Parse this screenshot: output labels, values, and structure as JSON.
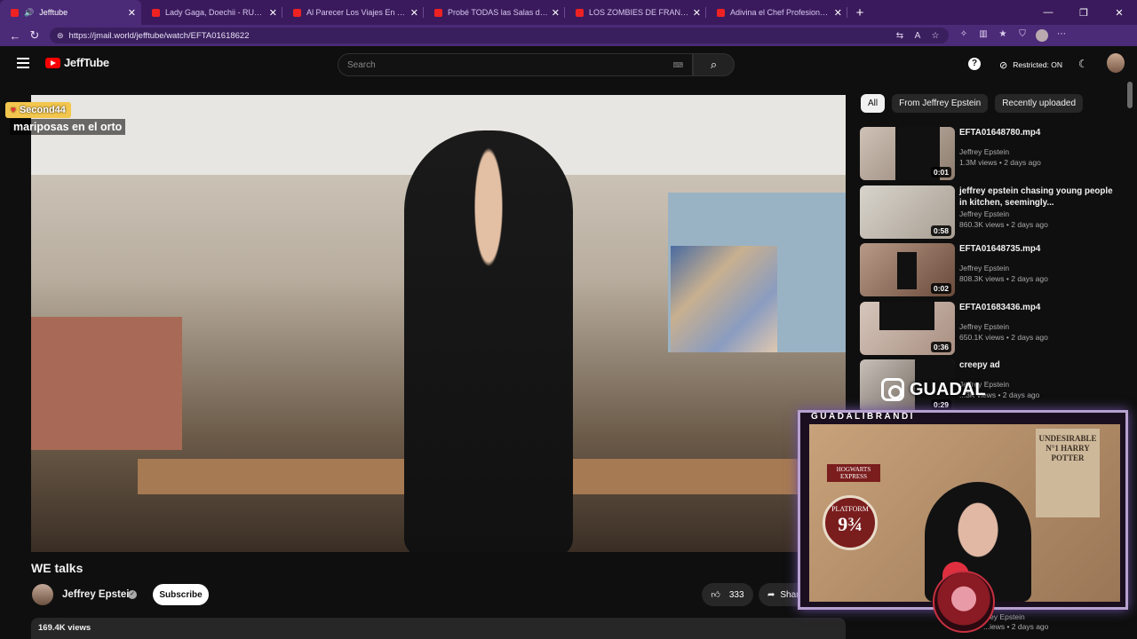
{
  "browser": {
    "tabs": [
      {
        "title": "Jefftube",
        "active": true,
        "audio": true
      },
      {
        "title": "Lady Gaga, Doechii - RUNWAY (O",
        "active": false
      },
      {
        "title": "Al Parecer Los Viajes En El Tiempo",
        "active": false
      },
      {
        "title": "Probé TODAS las Salas de Cine en",
        "active": false
      },
      {
        "title": "LOS ZOMBIES DE FRANKFURT (JA",
        "active": false
      },
      {
        "title": "Adivina el Chef Profesional - YouT",
        "active": false
      }
    ],
    "url": "https://jmail.world/jefftube/watch/EFTA01618622"
  },
  "header": {
    "logo_text": "JeffTube",
    "search_placeholder": "Search",
    "restricted_label": "Restricted: ON"
  },
  "overlay": {
    "chat_user": "Second44",
    "chat_message": "mariposas en el orto",
    "streamer_name": "GUADALIBRANDI",
    "ig_handle": "GUADAL",
    "poster_text": "UNDESIRABLE N°1 HARRY POTTER",
    "hogwarts_text": "HOGWARTS EXPRESS",
    "platform_text": "PLATFORM",
    "platform_number": "9¾"
  },
  "video": {
    "title": "WE talks",
    "channel": "Jeffrey Epstein",
    "subscribe_label": "Subscribe",
    "likes": "333",
    "share_label": "Share",
    "views": "169.4K views"
  },
  "chips": [
    "All",
    "From Jeffrey Epstein",
    "Recently uploaded"
  ],
  "recommendations": [
    {
      "title": "EFTA01648780.mp4",
      "channel": "Jeffrey Epstein",
      "meta": "1.3M views • 2 days ago",
      "duration": "0:01"
    },
    {
      "title": "jeffrey epstein chasing young people in kitchen, seemingly...",
      "channel": "Jeffrey Epstein",
      "meta": "860.3K views • 2 days ago",
      "duration": "0:58"
    },
    {
      "title": "EFTA01648735.mp4",
      "channel": "Jeffrey Epstein",
      "meta": "808.3K views • 2 days ago",
      "duration": "0:02"
    },
    {
      "title": "EFTA01683436.mp4",
      "channel": "Jeffrey Epstein",
      "meta": "650.1K views • 2 days ago",
      "duration": "0:36"
    },
    {
      "title": "creepy ad",
      "channel": "Jeffrey Epstein",
      "meta": "...3K views • 2 days ago",
      "duration": "0:29"
    }
  ],
  "hidden_rec": {
    "channel": "...ey Epstein",
    "meta": "...iews • 2 days ago"
  }
}
